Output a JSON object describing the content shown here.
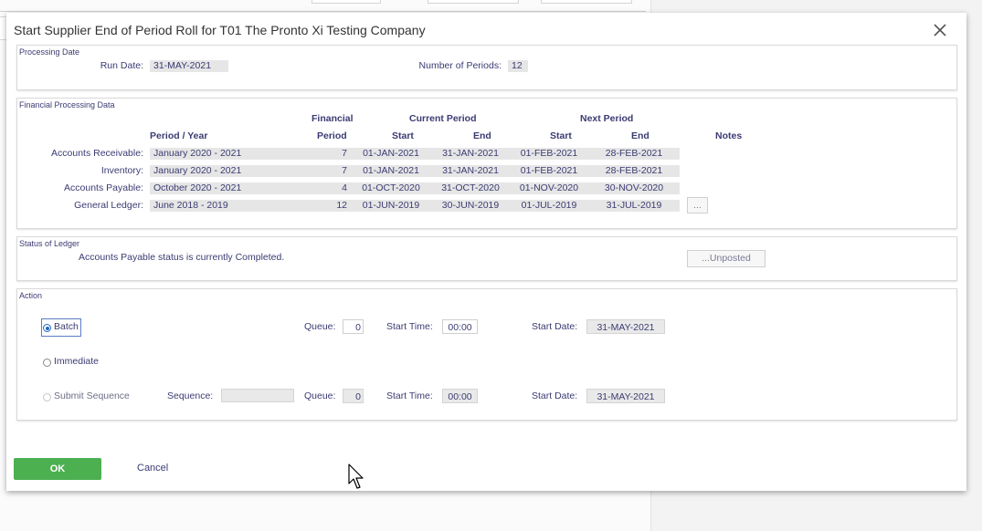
{
  "dialog": {
    "title": "Start Supplier End of Period Roll for T01 The Pronto Xi Testing Company",
    "close_icon": "close-icon"
  },
  "processing_date": {
    "legend": "Processing Date",
    "run_date_label": "Run Date:",
    "run_date_value": "31-MAY-2021",
    "num_periods_label": "Number of Periods:",
    "num_periods_value": "12"
  },
  "financial": {
    "legend": "Financial Processing Data",
    "headers": {
      "financial": "Financial",
      "current_period": "Current Period",
      "next_period": "Next Period",
      "period_year": "Period / Year",
      "period": "Period",
      "start": "Start",
      "end": "End",
      "next_start": "Start",
      "next_end": "End",
      "notes": "Notes"
    },
    "rows": [
      {
        "label": "Accounts Receivable:",
        "period_year": "January 2020 - 2021",
        "period": "7",
        "cur_start": "01-JAN-2021",
        "cur_end": "31-JAN-2021",
        "next_start": "01-FEB-2021",
        "next_end": "28-FEB-2021"
      },
      {
        "label": "Inventory:",
        "period_year": "January 2020 - 2021",
        "period": "7",
        "cur_start": "01-JAN-2021",
        "cur_end": "31-JAN-2021",
        "next_start": "01-FEB-2021",
        "next_end": "28-FEB-2021"
      },
      {
        "label": "Accounts Payable:",
        "period_year": "October 2020 - 2021",
        "period": "4",
        "cur_start": "01-OCT-2020",
        "cur_end": "31-OCT-2020",
        "next_start": "01-NOV-2020",
        "next_end": "30-NOV-2020"
      },
      {
        "label": "General Ledger:",
        "period_year": "June 2018 - 2019",
        "period": "12",
        "cur_start": "01-JUN-2019",
        "cur_end": "30-JUN-2019",
        "next_start": "01-JUL-2019",
        "next_end": "31-JUL-2019"
      }
    ],
    "ellipsis_button": "..."
  },
  "status": {
    "legend": "Status of Ledger",
    "message": "Accounts Payable status is currently Completed.",
    "unposted_button": "...Unposted"
  },
  "action": {
    "legend": "Action",
    "batch_label": "Batch",
    "immediate_label": "Immediate",
    "submit_sequence_label": "Submit Sequence",
    "sequence_label": "Sequence:",
    "sequence_value": "",
    "queue_label": "Queue:",
    "batch_queue_value": "0",
    "seq_queue_value": "0",
    "start_time_label": "Start Time:",
    "batch_start_time": "00:00",
    "seq_start_time": "00:00",
    "start_date_label": "Start Date:",
    "batch_start_date": "31-MAY-2021",
    "seq_start_date": "31-MAY-2021",
    "selected": "Batch"
  },
  "footer": {
    "ok_label": "OK",
    "cancel_label": "Cancel"
  },
  "colors": {
    "ok_button": "#4caf50",
    "label_text": "#3b3b73",
    "radio_selected": "#1f66c7"
  }
}
